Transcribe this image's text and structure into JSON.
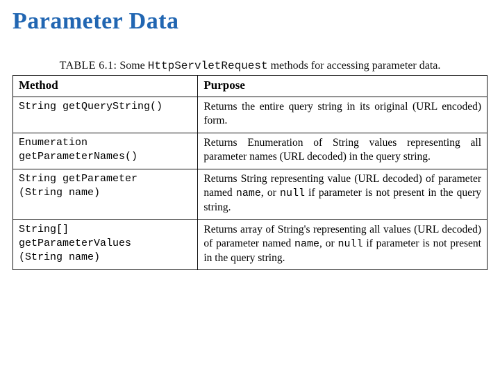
{
  "title": "Parameter Data",
  "caption": {
    "label": "TABLE 6.1:",
    "before": " Some ",
    "code": "HttpServletRequest",
    "after": " methods for accessing parameter data."
  },
  "headers": {
    "method": "Method",
    "purpose": "Purpose"
  },
  "rows": [
    {
      "method": "String getQueryString()",
      "purpose": "Returns the entire query string in its original (URL encoded) form."
    },
    {
      "method": "Enumeration\ngetParameterNames()",
      "purpose": "Returns Enumeration of String values representing all parameter names (URL decoded) in the query string."
    },
    {
      "method": "String getParameter\n(String name)",
      "purpose_parts": [
        {
          "t": "Returns String representing value (URL decoded) of parameter named "
        },
        {
          "tt": "name"
        },
        {
          "t": ", or "
        },
        {
          "tt": "null"
        },
        {
          "t": " if parameter is not present in the query string."
        }
      ]
    },
    {
      "method": "String[]\ngetParameterValues\n(String name)",
      "purpose_parts": [
        {
          "t": "Returns array of String's representing all values (URL decoded) of parameter named "
        },
        {
          "tt": "name"
        },
        {
          "t": ", or "
        },
        {
          "tt": "null"
        },
        {
          "t": " if parameter is not present in the query string."
        }
      ]
    }
  ]
}
